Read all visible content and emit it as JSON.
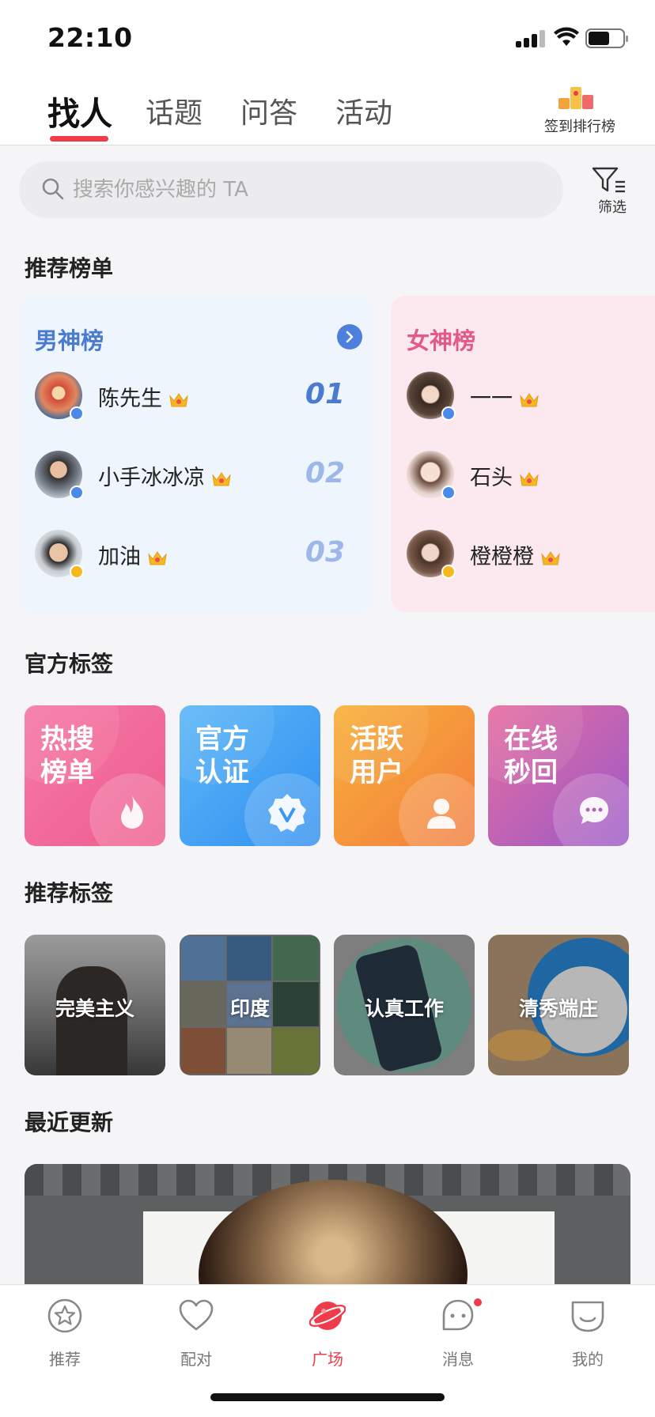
{
  "status_bar": {
    "time": "22:10"
  },
  "top_nav": {
    "tabs": [
      {
        "label": "找人",
        "active": true
      },
      {
        "label": "话题",
        "active": false
      },
      {
        "label": "问答",
        "active": false
      },
      {
        "label": "活动",
        "active": false
      }
    ],
    "checkin_label": "签到排行榜",
    "accent_color": "#ef3b4a"
  },
  "search": {
    "placeholder": "搜索你感兴趣的 TA",
    "value": ""
  },
  "filter_label": "筛选",
  "sections": {
    "ranking": "推荐榜单",
    "official_tags": "官方标签",
    "recommend_tags": "推荐标签",
    "recent": "最近更新"
  },
  "male_list": {
    "title": "男神榜",
    "items": [
      {
        "name": "陈先生",
        "rank": "01"
      },
      {
        "name": "小手冰冰凉",
        "rank": "02"
      },
      {
        "name": "加油",
        "rank": "03"
      }
    ]
  },
  "female_list": {
    "title": "女神榜",
    "items": [
      {
        "name": "一一"
      },
      {
        "name": "石头"
      },
      {
        "name": "橙橙橙"
      }
    ]
  },
  "official_tags": [
    {
      "line1": "热搜",
      "line2": "榜单",
      "icon": "flame-icon"
    },
    {
      "line1": "官方",
      "line2": "认证",
      "icon": "verified-badge-icon"
    },
    {
      "line1": "活跃",
      "line2": "用户",
      "icon": "user-icon"
    },
    {
      "line1": "在线",
      "line2": "秒回",
      "icon": "chat-bubble-icon"
    }
  ],
  "recommend_tags": [
    {
      "label": "完美主义"
    },
    {
      "label": "印度"
    },
    {
      "label": "认真工作"
    },
    {
      "label": "清秀端庄"
    }
  ],
  "tabbar": [
    {
      "label": "推荐",
      "icon": "star-icon",
      "active": false
    },
    {
      "label": "配对",
      "icon": "heart-icon",
      "active": false
    },
    {
      "label": "广场",
      "icon": "planet-icon",
      "active": true
    },
    {
      "label": "消息",
      "icon": "message-icon",
      "active": false,
      "badge": true
    },
    {
      "label": "我的",
      "icon": "profile-icon",
      "active": false
    }
  ]
}
